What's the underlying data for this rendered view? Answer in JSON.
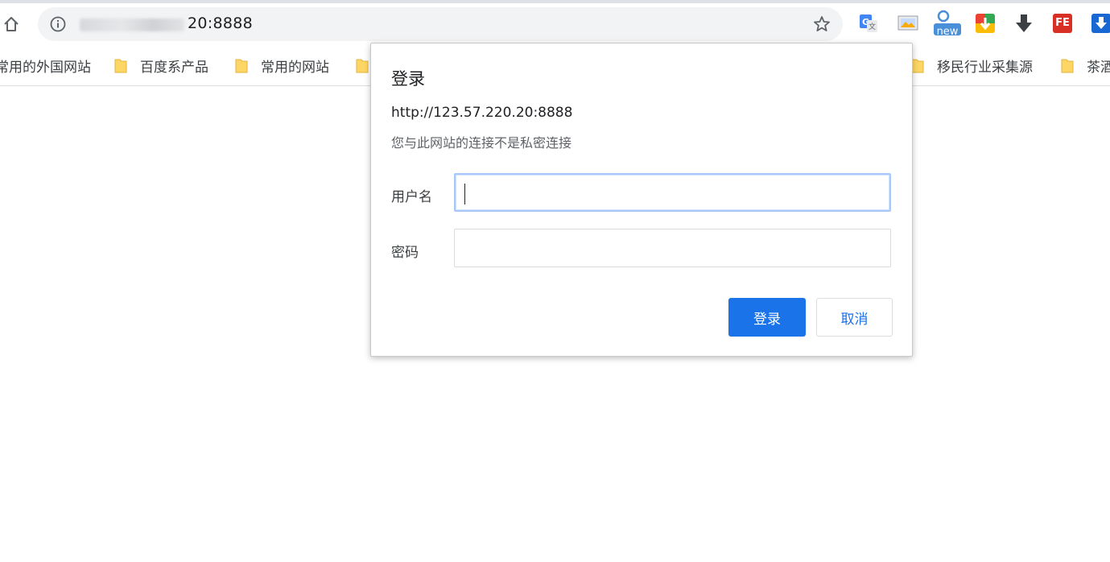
{
  "toolbar": {
    "url_visible": "20:8888",
    "bookmark_star": "bookmark-star-icon"
  },
  "extensions": [
    {
      "name": "google-translate-icon"
    },
    {
      "name": "image-tool-icon"
    },
    {
      "name": "new-badge-extension-icon",
      "badge": "new"
    },
    {
      "name": "color-download-icon"
    },
    {
      "name": "dark-download-icon"
    },
    {
      "name": "fe-helper-icon",
      "label": "FE"
    },
    {
      "name": "blue-download-icon"
    }
  ],
  "bookmarks": [
    {
      "label": "常用的外国网站"
    },
    {
      "label": "百度系产品"
    },
    {
      "label": "常用的网站"
    },
    {
      "label": "移民行业采集源"
    },
    {
      "label": "茶酒"
    }
  ],
  "dialog": {
    "title": "登录",
    "url": "http://123.57.220.20:8888",
    "note": "您与此网站的连接不是私密连接",
    "username_label": "用户名",
    "username_value": "",
    "password_label": "密码",
    "password_value": "",
    "login_button": "登录",
    "cancel_button": "取消"
  },
  "colors": {
    "primary": "#1a73e8",
    "omnibox_bg": "#f1f3f4",
    "focus_ring": "#a8c7fa"
  }
}
